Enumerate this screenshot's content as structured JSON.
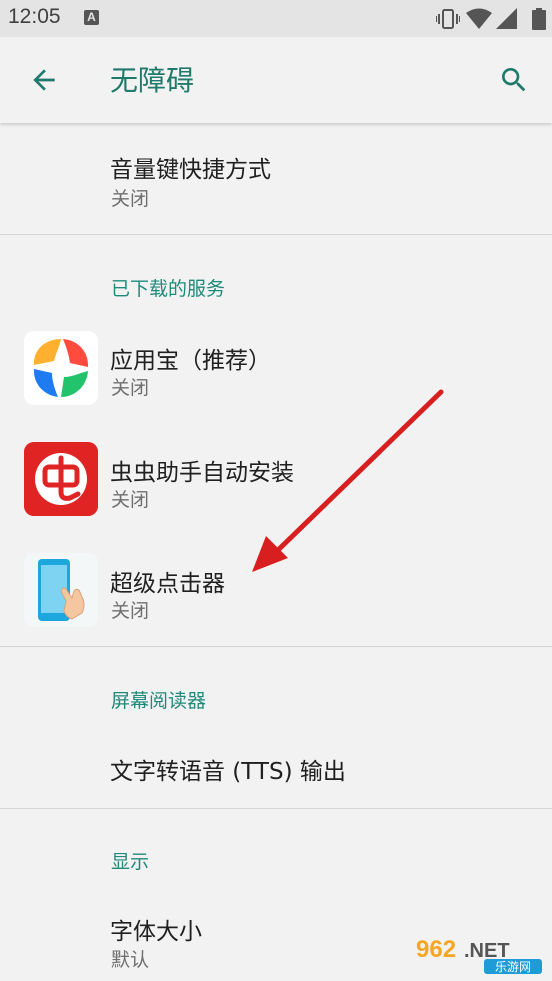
{
  "status_bar": {
    "time": "12:05",
    "notification_icon": "A"
  },
  "app_bar": {
    "title": "无障碍",
    "back_icon": "arrow-back-icon",
    "search_icon": "search-icon"
  },
  "items": {
    "volume_shortcut": {
      "title": "音量键快捷方式",
      "subtitle": "关闭"
    }
  },
  "sections": {
    "downloaded": "已下载的服务",
    "screen_reader": "屏幕阅读器",
    "display": "显示"
  },
  "services": [
    {
      "title": "应用宝（推荐）",
      "subtitle": "关闭",
      "icon": "yingyongbao-icon"
    },
    {
      "title": "虫虫助手自动安装",
      "subtitle": "关闭",
      "icon": "chongchong-icon"
    },
    {
      "title": "超级点击器",
      "subtitle": "关闭",
      "icon": "super-clicker-icon"
    }
  ],
  "screen_reader": {
    "tts": {
      "title": "文字转语音 (TTS) 输出"
    }
  },
  "display": {
    "font_size": {
      "title": "字体大小",
      "subtitle": "默认"
    }
  },
  "watermark": {
    "number": "962",
    "suffix": ".NET",
    "caption": "乐游网"
  },
  "colors": {
    "accent": "#1f8a79",
    "title_teal": "#1f7a6c",
    "annotation_arrow": "#d81e1e"
  }
}
